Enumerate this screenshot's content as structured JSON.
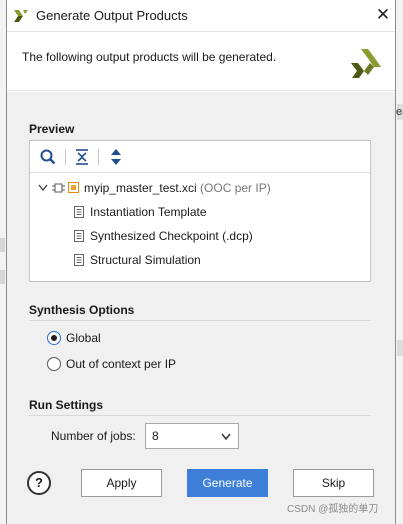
{
  "dialog": {
    "title": "Generate Output Products",
    "header_text": "The following output products will be generated."
  },
  "preview": {
    "label": "Preview",
    "root": {
      "name": "myip_master_test.xci",
      "suffix": "(OOC per IP)"
    },
    "children": [
      "Instantiation Template",
      "Synthesized Checkpoint (.dcp)",
      "Structural Simulation"
    ]
  },
  "synthesis": {
    "label": "Synthesis Options",
    "options": [
      {
        "label": "Global",
        "checked": true
      },
      {
        "label": "Out of context per IP",
        "checked": false
      }
    ]
  },
  "run_settings": {
    "label": "Run Settings",
    "jobs_label": "Number of jobs:",
    "jobs_value": "8"
  },
  "buttons": {
    "help": "?",
    "apply": "Apply",
    "generate": "Generate",
    "skip": "Skip"
  },
  "background": {
    "left_letter": "ea"
  },
  "watermark": "CSDN @孤独的单刀",
  "colors": {
    "accent": "#3d7ed8",
    "logo_green": "#8a9a2e",
    "logo_dark": "#4a5a12",
    "folder_orange": "#f0a030"
  }
}
